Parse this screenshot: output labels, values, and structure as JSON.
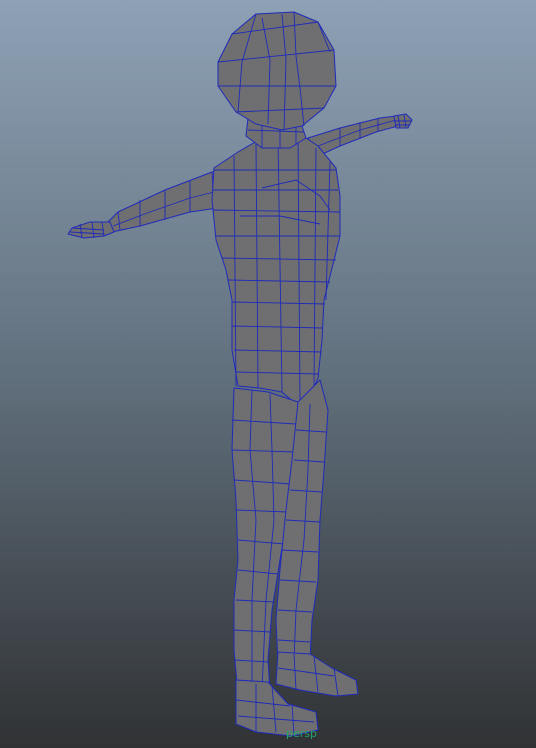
{
  "viewport": {
    "camera_label": "persp",
    "label_color": "#26a36b",
    "background_top": "#8ea1b5",
    "background_mid": "#61707d",
    "background_bottom": "#303234"
  },
  "mesh": {
    "object": "character-mesh",
    "pose": "T-pose",
    "display": "shaded-wireframe",
    "fill_color": "#6f6f72",
    "fill_shadow_color": "#55565a",
    "fill_highlight_color": "#8a8a8e",
    "wireframe_color": "#1f2bb8"
  }
}
